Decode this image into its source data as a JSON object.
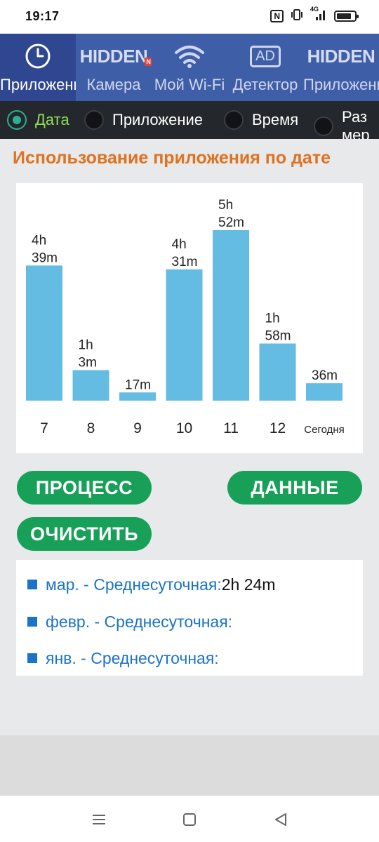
{
  "status_bar": {
    "time": "19:17",
    "nfc": "N",
    "network": "4G"
  },
  "tabs": [
    {
      "label": "Приложения",
      "icon": "clock-icon",
      "active": true
    },
    {
      "label": "Камера",
      "icon": "hidden-camera-logo",
      "logo_text": "HIDDEN",
      "badge": "N"
    },
    {
      "label": "Мой Wi-Fi",
      "icon": "wifi-icon"
    },
    {
      "label": "Детектор",
      "icon": "ad-icon",
      "icon_text": "AD"
    },
    {
      "label": "Приложения",
      "icon": "hidden-apps-logo",
      "logo_text": "HIDDEN"
    }
  ],
  "filters": [
    {
      "label": "Дата",
      "selected": true
    },
    {
      "label": "Приложение",
      "selected": false
    },
    {
      "label": "Время",
      "selected": false
    },
    {
      "label": "Раз мер",
      "selected": false
    }
  ],
  "section_title": "Использование приложения по дате",
  "chart_data": {
    "type": "bar",
    "categories": [
      "7",
      "8",
      "9",
      "10",
      "11",
      "12",
      "Сегодня"
    ],
    "values_minutes": [
      279,
      63,
      17,
      271,
      352,
      118,
      36
    ],
    "data_labels": [
      [
        "4h",
        "39m"
      ],
      [
        "1h",
        "3m"
      ],
      [
        "17m"
      ],
      [
        "4h",
        "31m"
      ],
      [
        "5h",
        "52m"
      ],
      [
        "1h",
        "58m"
      ],
      [
        "36m"
      ]
    ],
    "color": "#65bce3",
    "ylim": [
      0,
      352
    ],
    "grid": false,
    "legend": "none"
  },
  "buttons": {
    "process": "ПРОЦЕСС",
    "data": "ДАННЫЕ",
    "clear": "ОЧИСТИТЬ"
  },
  "stats": [
    {
      "label": "мар. - Среднесуточная:",
      "value": "2h 24m"
    },
    {
      "label": "февр. - Среднесуточная:",
      "value": ""
    },
    {
      "label": "янв. - Среднесуточная:",
      "value": ""
    }
  ],
  "colors": {
    "tab_bar": "#3f5ea8",
    "tab_active": "#2f4790",
    "accent_title": "#e0711f",
    "button_green": "#18a058",
    "stat_blue": "#1a73c8",
    "radio_selected": "#2bb094"
  }
}
